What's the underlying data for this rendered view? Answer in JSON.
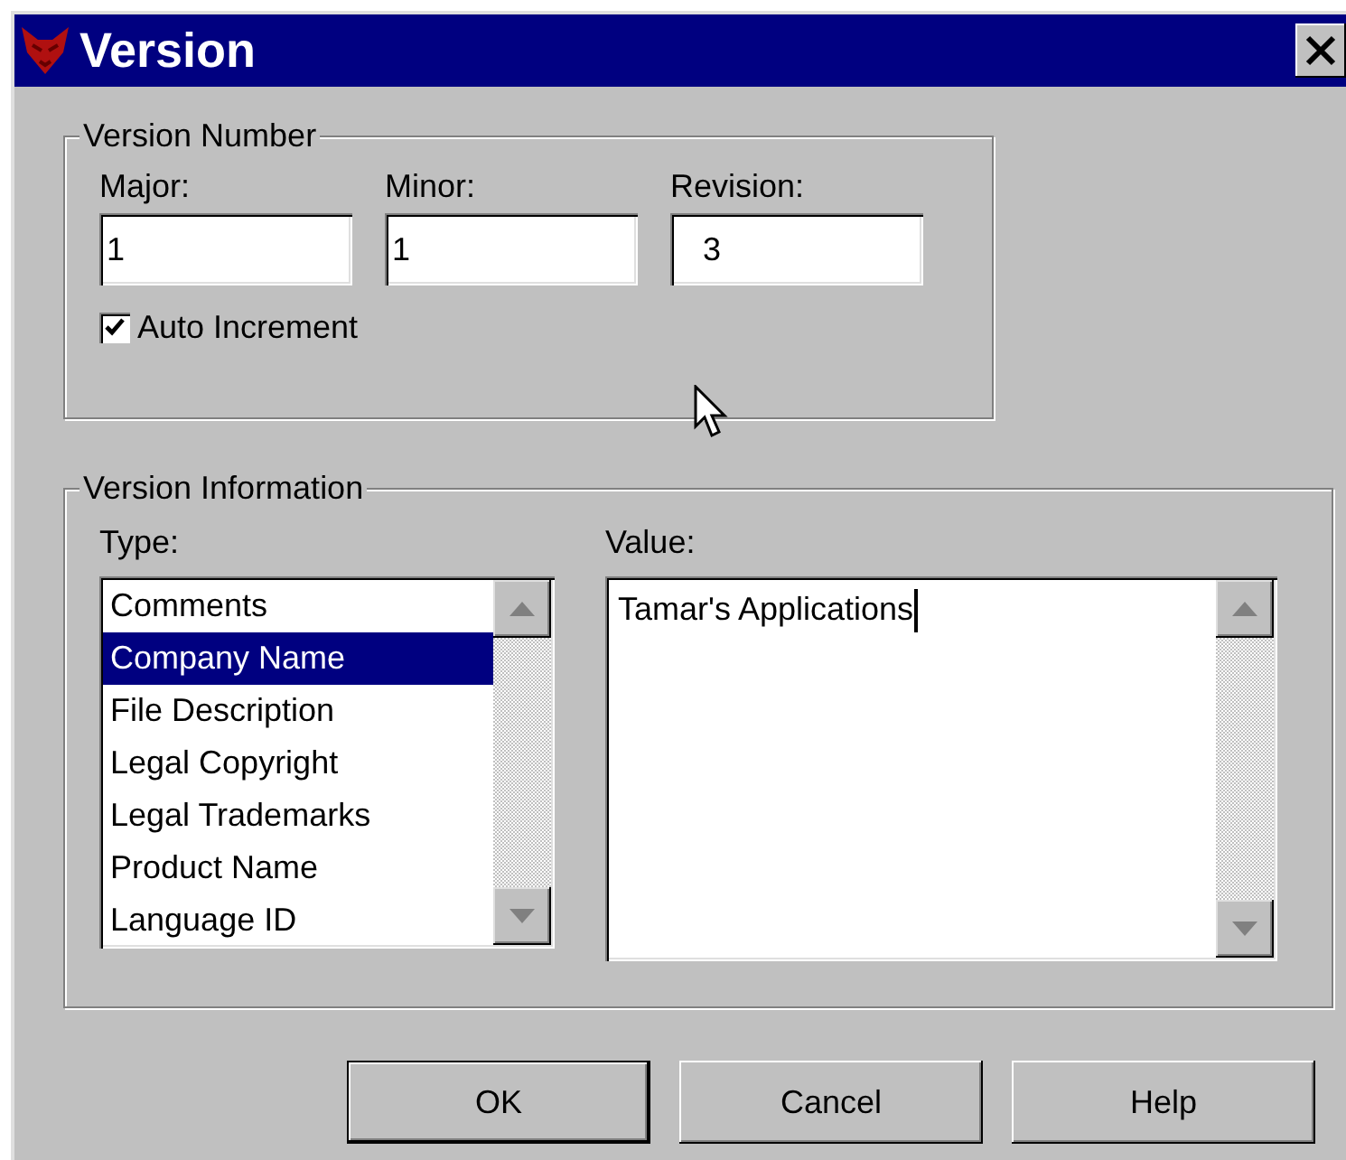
{
  "window": {
    "title": "Version"
  },
  "version_number": {
    "title": "Version Number",
    "fields": [
      {
        "label": "Major:",
        "value": "1"
      },
      {
        "label": "Minor:",
        "value": "1"
      },
      {
        "label": "Revision:",
        "value": "3"
      }
    ],
    "auto_increment": {
      "label": "Auto Increment",
      "checked": true
    }
  },
  "version_information": {
    "title": "Version Information",
    "type_label": "Type:",
    "types": [
      {
        "label": "Comments",
        "selected": false
      },
      {
        "label": "Company Name",
        "selected": true
      },
      {
        "label": "File Description",
        "selected": false
      },
      {
        "label": "Legal Copyright",
        "selected": false
      },
      {
        "label": "Legal Trademarks",
        "selected": false
      },
      {
        "label": "Product Name",
        "selected": false
      },
      {
        "label": "Language ID",
        "selected": false
      }
    ],
    "value_label": "Value:",
    "value": "Tamar's Applications"
  },
  "buttons": [
    {
      "label": "OK",
      "default": true
    },
    {
      "label": "Cancel",
      "default": false
    },
    {
      "label": "Help",
      "default": false
    }
  ]
}
